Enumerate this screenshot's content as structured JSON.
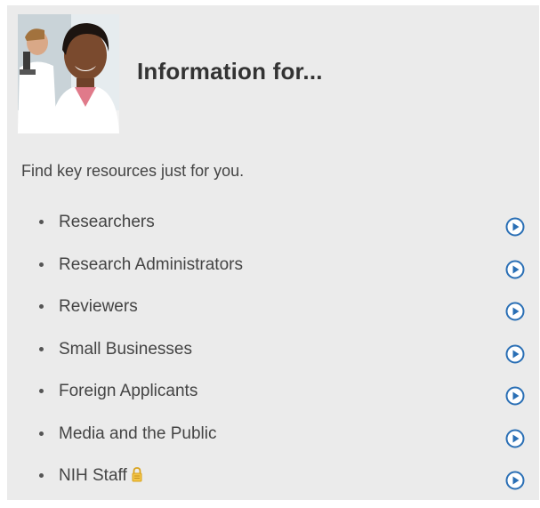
{
  "header": {
    "title": "Information for..."
  },
  "intro": "Find key resources just for you.",
  "items": [
    {
      "label": "Researchers",
      "locked": false
    },
    {
      "label": "Research Administrators",
      "locked": false
    },
    {
      "label": "Reviewers",
      "locked": false
    },
    {
      "label": "Small Businesses",
      "locked": false
    },
    {
      "label": "Foreign Applicants",
      "locked": false
    },
    {
      "label": "Media and the Public",
      "locked": false
    },
    {
      "label": "NIH Staff",
      "locked": true
    }
  ],
  "colors": {
    "panel_background": "#ebebeb",
    "arrow_icon": "#2a6fb5",
    "lock_icon": "#d9a21b"
  },
  "icons": {
    "item_action": "circle-play-icon",
    "restricted": "lock-icon"
  }
}
